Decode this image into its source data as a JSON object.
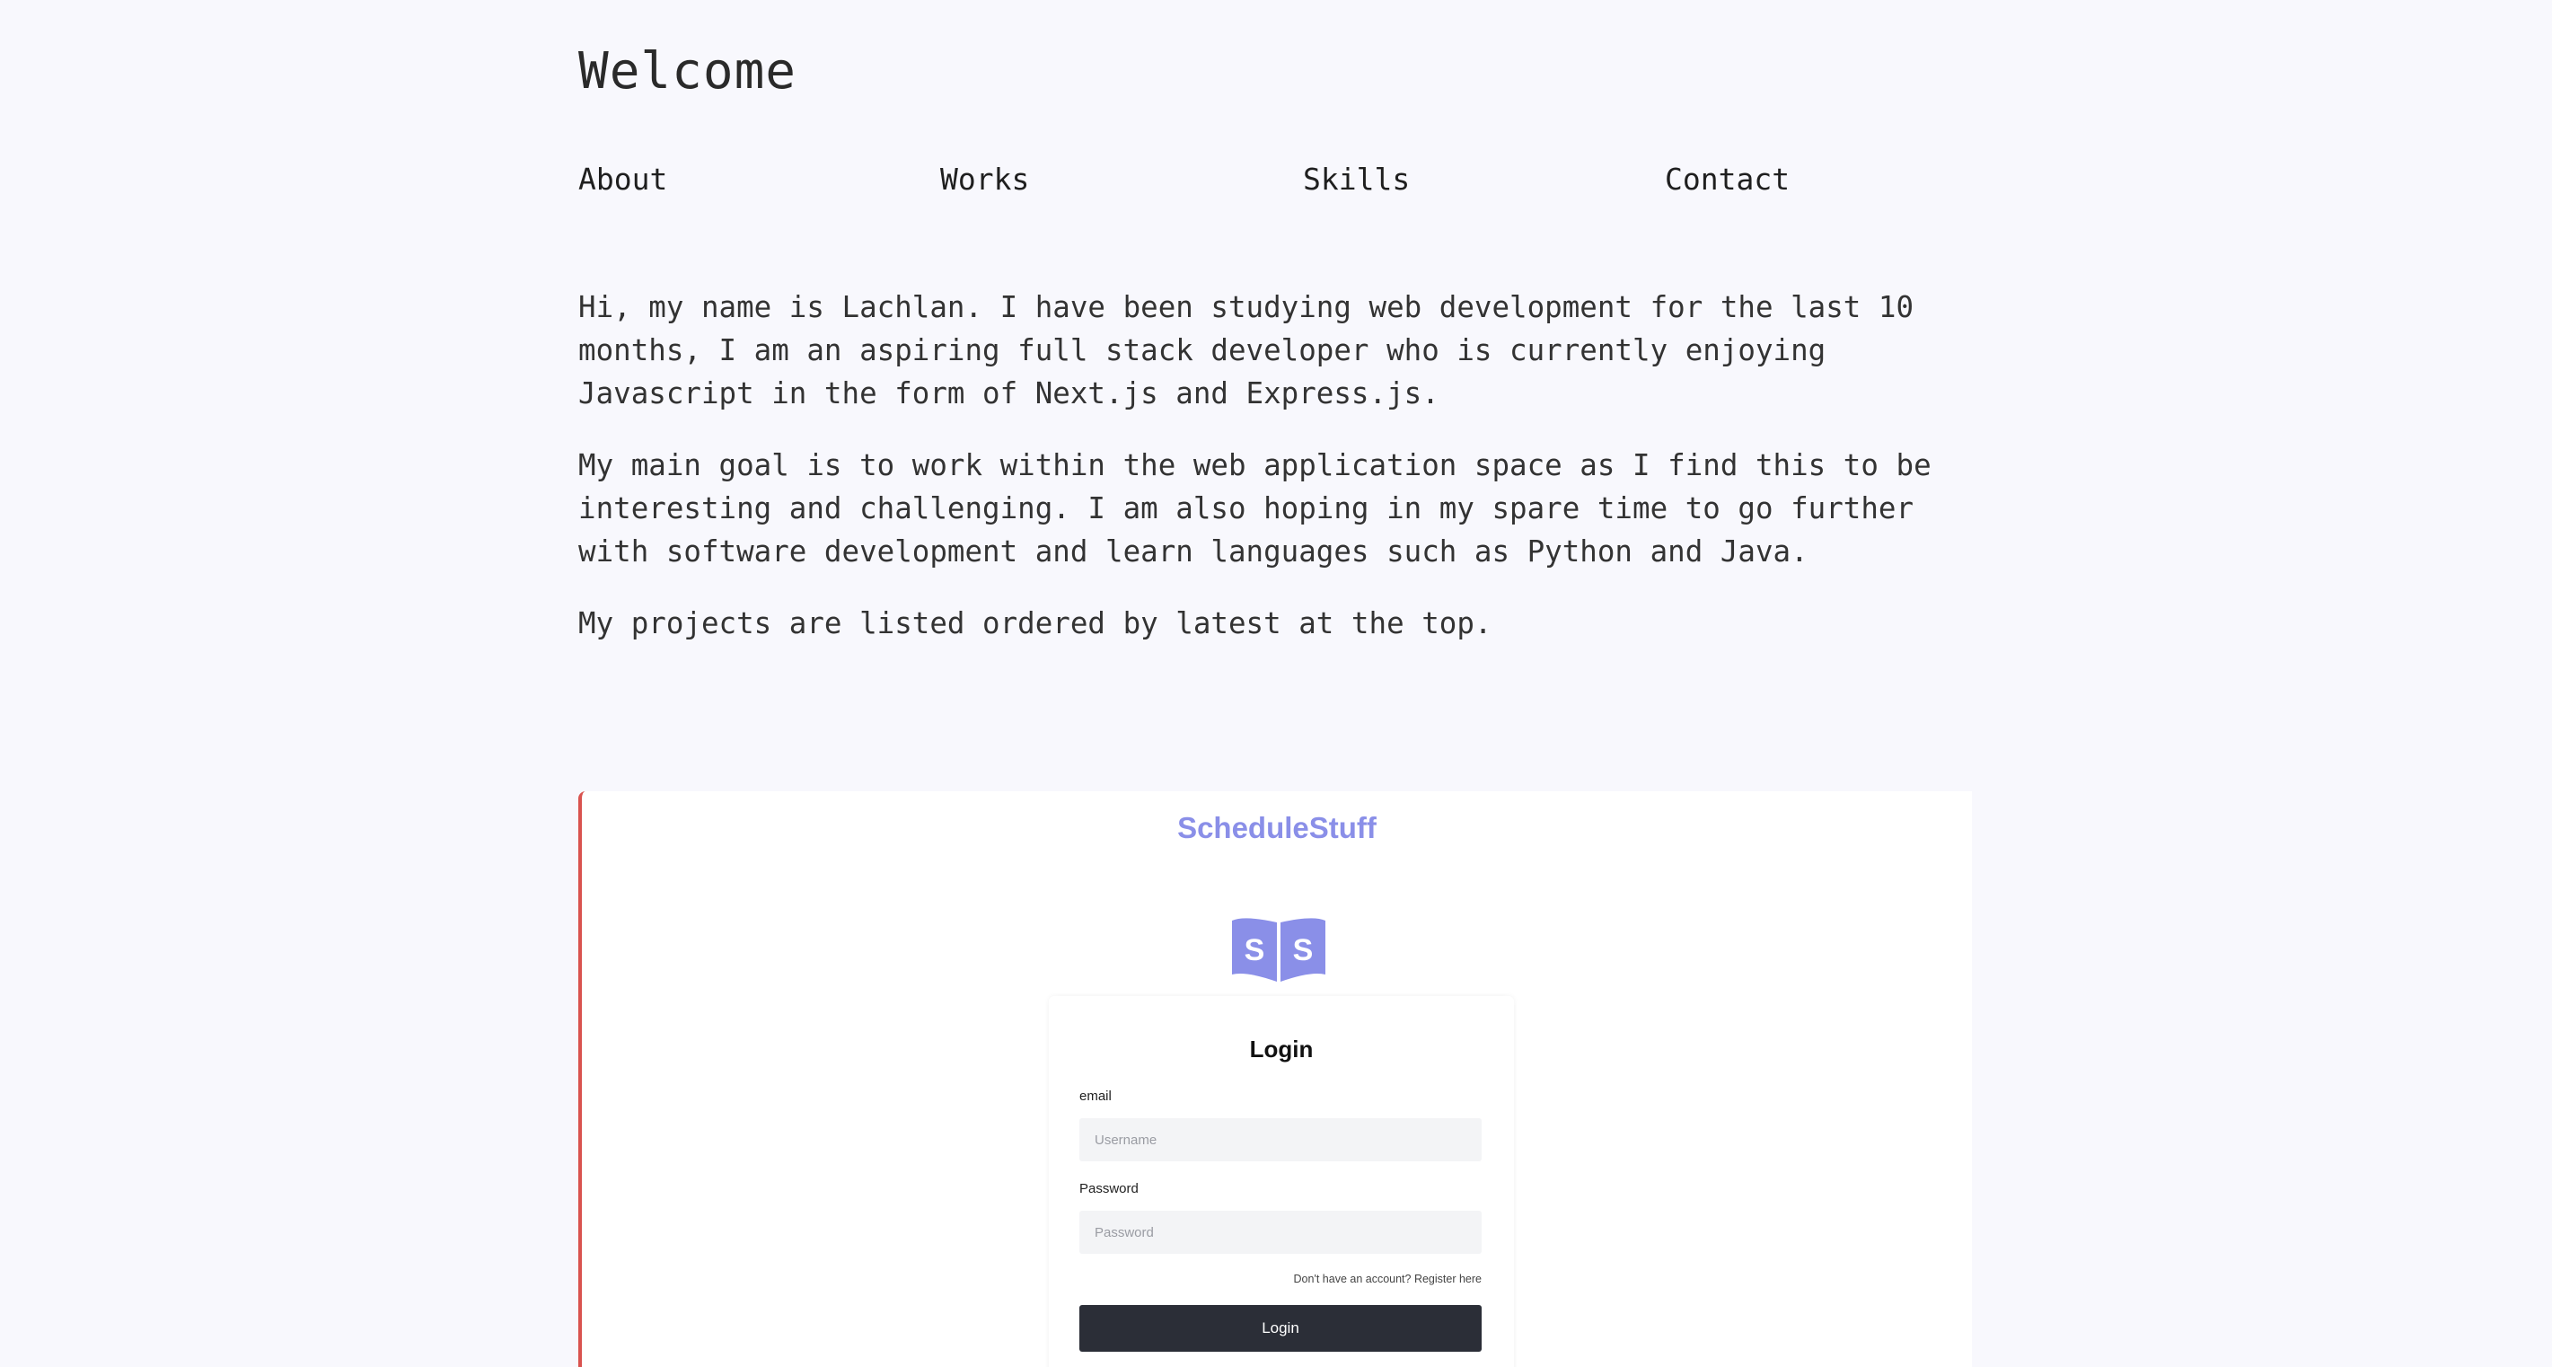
{
  "header": {
    "title": "Welcome"
  },
  "nav": {
    "items": [
      {
        "label": "About"
      },
      {
        "label": "Works"
      },
      {
        "label": "Skills"
      },
      {
        "label": "Contact"
      }
    ]
  },
  "intro": {
    "paragraphs": [
      "Hi, my name is Lachlan. I have been studying web development for the last 10 months, I am an aspiring full stack developer who is currently enjoying Javascript in the form of Next.js and Express.js.",
      "My main goal is to work within the web application space as I find this to be interesting and challenging. I am also hoping in my spare time to go further with software development and learn languages such as Python and Java.",
      "My projects are listed ordered by latest at the top."
    ]
  },
  "project": {
    "brand": "ScheduleStuff",
    "logo_letters": [
      "S",
      "S"
    ],
    "login": {
      "title": "Login",
      "email_label": "email",
      "email_placeholder": "Username",
      "password_label": "Password",
      "password_placeholder": "Password",
      "register_text": "Don't have an account? Register here",
      "button_label": "Login"
    }
  },
  "colors": {
    "background": "#f8f8fd",
    "accent_border": "#d9534f",
    "brand": "#8a8fe8",
    "button": "#2b2e37"
  }
}
